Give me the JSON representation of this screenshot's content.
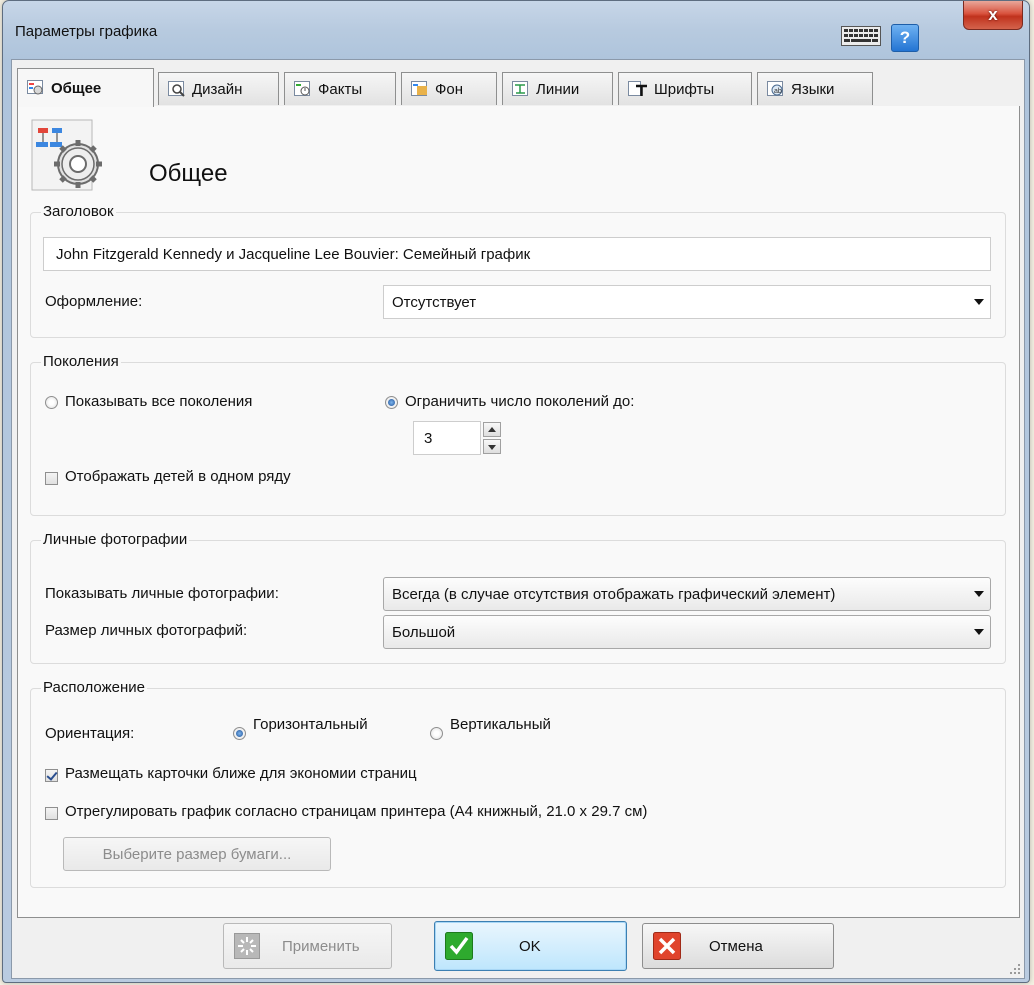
{
  "window": {
    "title": "Параметры графика",
    "help_label": "?",
    "close_label": "x"
  },
  "tabs": [
    {
      "label": "Общее",
      "icon": "general-tab-icon",
      "active": true
    },
    {
      "label": "Дизайн",
      "icon": "design-tab-icon"
    },
    {
      "label": "Факты",
      "icon": "facts-tab-icon"
    },
    {
      "label": "Фон",
      "icon": "background-tab-icon"
    },
    {
      "label": "Линии",
      "icon": "lines-tab-icon"
    },
    {
      "label": "Шрифты",
      "icon": "fonts-tab-icon"
    },
    {
      "label": "Языки",
      "icon": "languages-tab-icon"
    }
  ],
  "page": {
    "heading": "Общее"
  },
  "title_group": {
    "legend": "Заголовок",
    "title_value": "John Fitzgerald Kennedy и Jacqueline Lee Bouvier: Семейный график",
    "style_label": "Оформление:",
    "style_value": "Отсутствует"
  },
  "generations": {
    "legend": "Поколения",
    "show_all_label": "Показывать все поколения",
    "show_all_selected": false,
    "limit_label": "Ограничить число поколений до:",
    "limit_selected": true,
    "limit_value": "3",
    "children_one_row_label": "Отображать детей в одном ряду",
    "children_one_row_checked": false
  },
  "photos": {
    "legend": "Личные фотографии",
    "show_label": "Показывать личные фотографии:",
    "show_value": "Всегда (в случае отсутствия отображать графический элемент)",
    "size_label": "Размер личных фотографий:",
    "size_value": "Большой"
  },
  "layout": {
    "legend": "Расположение",
    "orientation_label": "Ориентация:",
    "horizontal_label": "Горизонтальный",
    "horizontal_selected": true,
    "vertical_label": "Вертикальный",
    "vertical_selected": false,
    "compact_label": "Размещать карточки ближе для экономии страниц",
    "compact_checked": true,
    "fit_printer_label": "Отрегулировать график согласно страницам принтера (А4 книжный, 21.0 x 29.7 см)",
    "fit_printer_checked": false,
    "paper_size_button": "Выберите размер бумаги..."
  },
  "footer": {
    "apply_label": "Применить",
    "ok_label": "OK",
    "cancel_label": "Отмена"
  },
  "colors": {
    "ok_green": "#2eaa2e",
    "cancel_red": "#e0442c",
    "accent_blue": "#3c7fb1"
  }
}
